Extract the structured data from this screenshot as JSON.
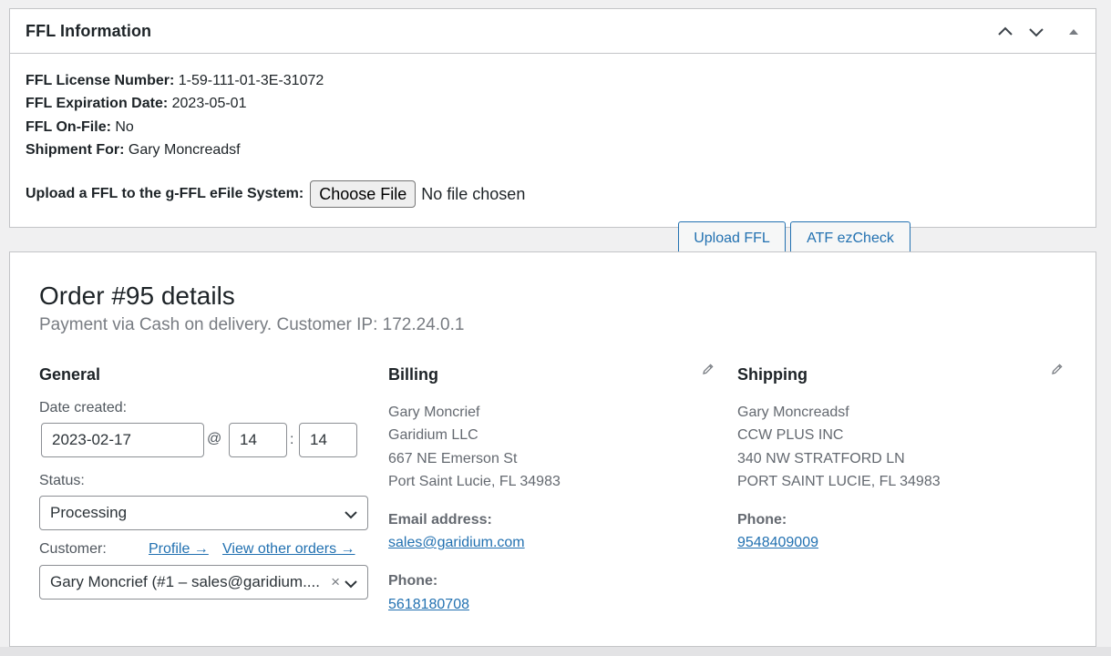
{
  "ffl": {
    "title": "FFL Information",
    "license_label": "FFL License Number:",
    "license_value": " 1-59-111-01-3E-31072",
    "expiration_label": "FFL Expiration Date:",
    "expiration_value": " 2023-05-01",
    "onfile_label": "FFL On-File:",
    "onfile_value": " No",
    "shipment_label": "Shipment For:",
    "shipment_value": " Gary Moncreadsf",
    "upload_label": "Upload a FFL to the g-FFL eFile System:",
    "choose_file": "Choose File",
    "no_file": "No file chosen",
    "upload_button": "Upload FFL",
    "atf_button": "ATF ezCheck"
  },
  "order": {
    "title": "Order #95 details",
    "subtitle": "Payment via Cash on delivery. Customer IP: 172.24.0.1",
    "general": {
      "heading": "General",
      "date_label": "Date created:",
      "date_value": "2023-02-17",
      "at": "@",
      "hour": "14",
      "colon": ":",
      "minute": "14",
      "status_label": "Status:",
      "status_value": "Processing",
      "customer_label": "Customer:",
      "profile_link": "Profile →",
      "other_orders_link": "View other orders →",
      "customer_value": "Gary Moncrief (#1 – sales@garidium....",
      "clear": "×"
    },
    "billing": {
      "heading": "Billing",
      "name": "Gary Moncrief",
      "company": "Garidium LLC",
      "street": "667 NE Emerson St",
      "city": "Port Saint Lucie, FL 34983",
      "email_label": "Email address:",
      "email": "sales@garidium.com",
      "phone_label": "Phone:",
      "phone": "5618180708"
    },
    "shipping": {
      "heading": "Shipping",
      "name": "Gary Moncreadsf",
      "company": "CCW PLUS INC",
      "street": "340 NW STRATFORD LN",
      "city": "PORT SAINT LUCIE, FL 34983",
      "phone_label": "Phone:",
      "phone": "9548409009"
    }
  },
  "icons": {
    "move_up": "chevron-up-icon",
    "move_down": "chevron-down-icon",
    "toggle": "triangle-up-icon",
    "edit": "pencil-icon"
  },
  "colors": {
    "link": "#2271b1",
    "border": "#c3c4c7",
    "muted": "#646970"
  }
}
